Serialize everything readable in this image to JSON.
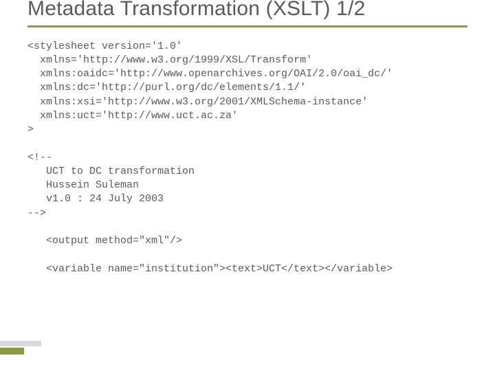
{
  "title": "Metadata Transformation (XSLT) 1/2",
  "code": {
    "l1": "<stylesheet version='1.0'",
    "l2": "  xmlns='http://www.w3.org/1999/XSL/Transform'",
    "l3": "  xmlns:oaidc='http://www.openarchives.org/OAI/2.0/oai_dc/'",
    "l4": "  xmlns:dc='http://purl.org/dc/elements/1.1/'",
    "l5": "  xmlns:xsi='http://www.w3.org/2001/XMLSchema-instance'",
    "l6": "  xmlns:uct='http://www.uct.ac.za'",
    "l7": ">",
    "l8": "",
    "l9": "<!--",
    "l10": "   UCT to DC transformation",
    "l11": "   Hussein Suleman",
    "l12": "   v1.0 : 24 July 2003",
    "l13": "-->",
    "l14": "",
    "l15": "   <output method=\"xml\"/>",
    "l16": "",
    "l17": "   <variable name=\"institution\"><text>UCT</text></variable>"
  }
}
